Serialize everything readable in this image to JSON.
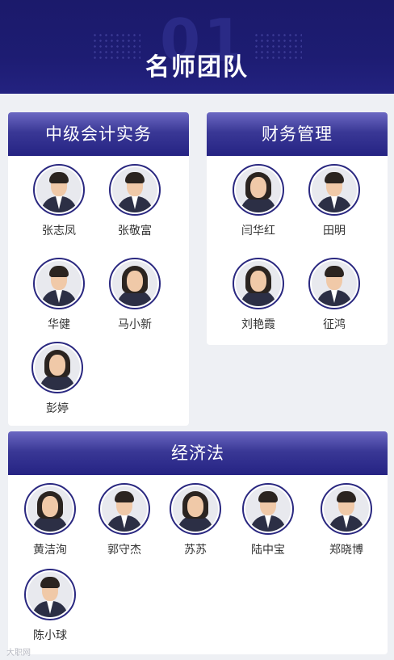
{
  "header": {
    "title": "名师团队",
    "number": "01"
  },
  "sections": {
    "zhongji": {
      "title": "中级会计实务",
      "teachers": [
        "张志凤",
        "张敬富",
        "华健",
        "马小新",
        "彭婷"
      ]
    },
    "caiwu": {
      "title": "财务管理",
      "teachers": [
        "闫华红",
        "田明",
        "刘艳霞",
        "征鸿"
      ]
    },
    "jingji": {
      "title": "经济法",
      "teachers": [
        "黄洁洵",
        "郭守杰",
        "苏苏",
        "陆中宝",
        "郑晓博",
        "陈小球"
      ]
    }
  },
  "colors": {
    "header_bg": "#1d1c72",
    "panel_head": "#2e2c8a",
    "page_bg": "#eef0f4"
  },
  "watermark": "大职网"
}
